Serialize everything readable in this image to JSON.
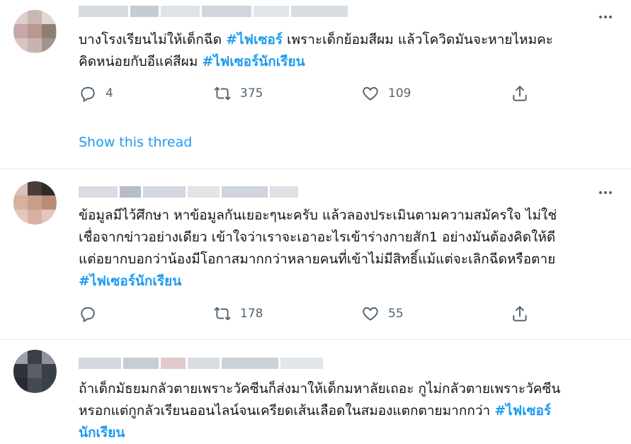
{
  "tweets": [
    {
      "text_before": "บางโรงเรียนไม่ให้เด็กฉีด ",
      "tag1": "#ไฟเซอร์",
      "text_mid": " เพราะเด็กย้อมสีผม แล้วโควิดมันจะหายไหมคะ\nคิดหน่อยกับอีแค่สีผม ",
      "tag2": "#ไฟเซอร์นักเรียน",
      "replies": "4",
      "retweets": "375",
      "likes": "109",
      "show_thread": "Show this thread"
    },
    {
      "text": "ข้อมูลมีไว้ศึกษา หาข้อมูลกันเยอะๆนะครับ แล้วลองประเมินตามความสมัครใจ ไม่ใช่\nเชื่อจากข่าวอย่างเดียว เข้าใจว่าเราจะเอาอะไรเข้าร่างกายสัก1 อย่างมันต้องคิดให้ดี\nแต่อยากบอกว่าน้องมีโอกาสมากกว่าหลายคนที่เข้าไม่มีสิทธิ์แม้แต่จะเลิกฉีดหรือตาย\n",
      "tag": "#ไฟเซอร์นักเรียน",
      "replies": "",
      "retweets": "178",
      "likes": "55"
    },
    {
      "text": "ถ้าเด็กมัธยมกลัวตายเพราะวัคซีนก็ส่งมาให้เด็กมหาลัยเถอะ กูไม่กลัวตายเพราะวัคซีน\nหรอกแต่กูกลัวเรียนออนไลน์จนเครียดเส้นเลือดในสมองแตกตายมากกว่า ",
      "tag": "#ไฟเซอร์\nนักเรียน"
    }
  ],
  "icons": {
    "more": "more-horizontal-icon",
    "reply": "reply-icon",
    "retweet": "retweet-icon",
    "like": "heart-icon",
    "share": "share-icon"
  },
  "colors": {
    "accent": "#1d9bf0",
    "muted": "#536471",
    "divider": "#e6ecf0"
  }
}
